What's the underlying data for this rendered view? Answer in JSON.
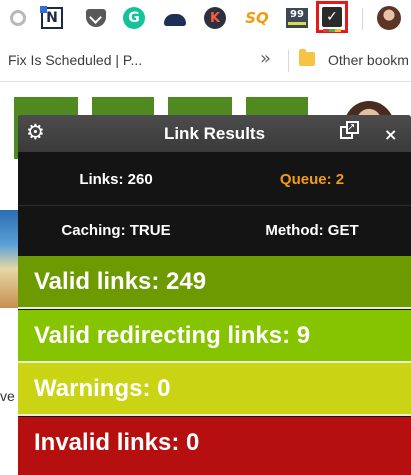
{
  "browser": {
    "bookmark_left": "Fix Is Scheduled | P...",
    "bookmark_overflow": "»",
    "bookmark_other": "Other bookm",
    "ext_n_label": "N",
    "ext_g_label": "G",
    "ext_k_label": "K",
    "ext_sq_label": "SQ",
    "ext_99_label": "99",
    "active_ext_label": "✓"
  },
  "page": {
    "partial_text": "ve"
  },
  "popup": {
    "title": "Link Results",
    "close_label": "×",
    "stats": {
      "links": "Links: 260",
      "queue": "Queue: 2",
      "caching": "Caching: TRUE",
      "method": "Method: GET"
    },
    "results": {
      "valid": "Valid links: 249",
      "redirecting": "Valid redirecting links: 9",
      "warnings": "Warnings: 0",
      "invalid": "Invalid links: 0"
    }
  },
  "colors": {
    "valid": "#6c9a00",
    "redirecting": "#86c400",
    "warnings": "#cad414",
    "invalid": "#b50f0f",
    "queue": "#f39c12",
    "highlight_box": "#e3191a"
  },
  "icons": [
    "settings-gear-icon",
    "popout-icon",
    "close-icon",
    "folder-icon",
    "chevron-right-icon"
  ]
}
